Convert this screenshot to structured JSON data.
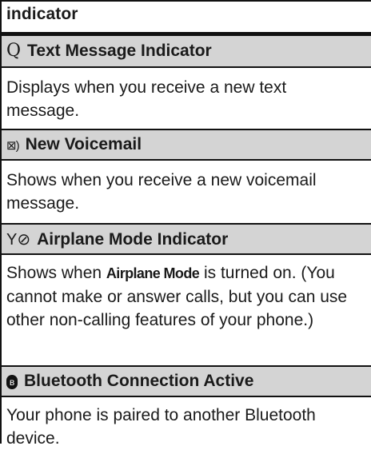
{
  "header": {
    "title": "indicator"
  },
  "rows": [
    {
      "icon": "Q",
      "icon_name": "text-message-icon",
      "title": "Text Message Indicator",
      "description": "Displays when you receive a new text message."
    },
    {
      "icon": "⊠)",
      "icon_name": "voicemail-icon",
      "title": "New Voicemail",
      "description": "Shows when you receive a new voicemail message."
    },
    {
      "icon": "Y⊘",
      "icon_name": "airplane-mode-icon",
      "title": "Airplane Mode Indicator",
      "description_pre": "Shows when ",
      "description_emph": "Airplane Mode",
      "description_post": " is turned on. (You cannot make or answer calls, but you can use other non-calling features of your phone.)"
    },
    {
      "icon": "ʙ",
      "icon_name": "bluetooth-icon",
      "title": "Bluetooth Connection Active",
      "description": "Your phone is paired to another Bluetooth device."
    }
  ]
}
